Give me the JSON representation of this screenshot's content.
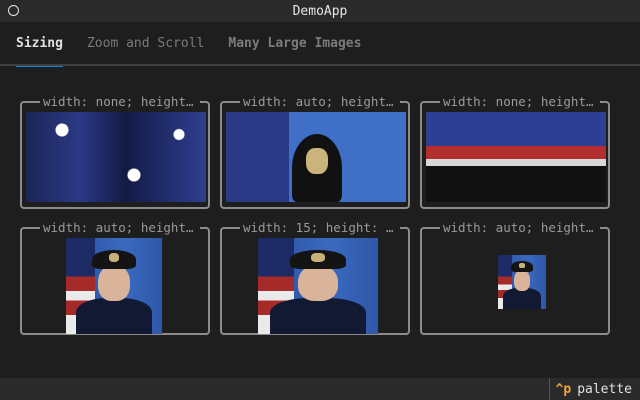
{
  "window": {
    "title": "DemoApp"
  },
  "tabs": [
    {
      "label": "Sizing",
      "active": true
    },
    {
      "label": "Zoom and Scroll",
      "active": false
    },
    {
      "label": "Many Large Images",
      "active": false
    }
  ],
  "cells": [
    {
      "label": "width: none; height: ...",
      "image": "flag-closeup"
    },
    {
      "label": "width: auto; height: ...",
      "image": "flag-cap-badge"
    },
    {
      "label": "width: none; height: ...",
      "image": "flag-shoulder"
    },
    {
      "label": "width: auto; height: ...",
      "image": "portrait"
    },
    {
      "label": "width: 15; height: ...",
      "image": "portrait"
    },
    {
      "label": "width: auto; height: ...",
      "image": "portrait-small"
    }
  ],
  "statusbar": {
    "key": "^p",
    "label": "palette"
  },
  "colors": {
    "accent": "#1e7fd6",
    "key": "#f0a43a"
  }
}
